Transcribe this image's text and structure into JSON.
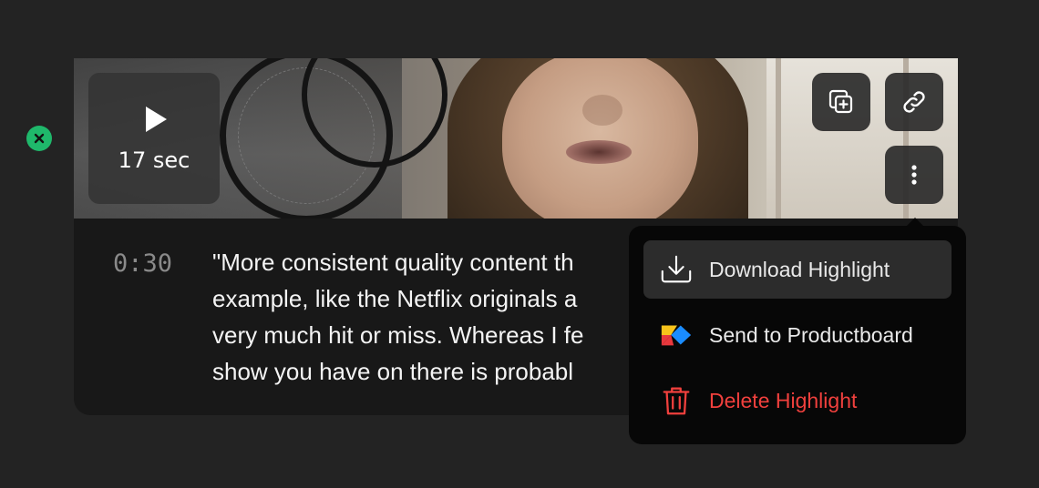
{
  "remove_button": {
    "icon": "close-icon",
    "color": "#1fb86b"
  },
  "video": {
    "duration_label": "17 sec",
    "play_icon": "play-icon",
    "actions": [
      {
        "name": "copy-to-board",
        "icon": "copy-plus-icon"
      },
      {
        "name": "copy-link",
        "icon": "link-icon"
      },
      {
        "name": "more-options",
        "icon": "more-vertical-icon"
      }
    ]
  },
  "transcript": {
    "timestamp": "0:30",
    "lines": [
      "\"More consistent quality content th",
      "example, like the Netflix originals a",
      "very much hit or miss. Whereas I fe",
      "show you have on there is probabl"
    ]
  },
  "menu": {
    "items": [
      {
        "label": "Download Highlight",
        "icon": "download-icon",
        "active": true
      },
      {
        "label": "Send to Productboard",
        "icon": "productboard-icon",
        "active": false
      },
      {
        "label": "Delete Highlight",
        "icon": "trash-icon",
        "danger": true,
        "color": "#f0403d"
      }
    ]
  }
}
